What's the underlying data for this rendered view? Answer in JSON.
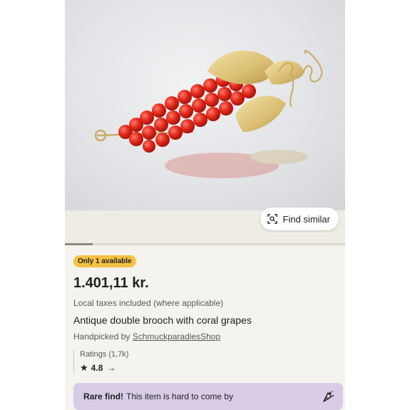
{
  "hero": {
    "image": "coral-grapes-brooch-photo"
  },
  "find_similar": {
    "label": "Find similar",
    "icon": "visual-search-icon"
  },
  "gallery": {
    "progress": 0.1
  },
  "listing": {
    "badge": "Only 1 available",
    "price": "1.401,11 kr.",
    "tax_note": "Local taxes included (where applicable)",
    "title": "Antique double brooch with coral grapes",
    "handpicked_prefix": "Handpicked by ",
    "shop_name": "SchmuckparadiesShop"
  },
  "ratings": {
    "label": "Ratings (1,7k)",
    "star_icon": "star-icon",
    "value": "4.8",
    "arrow": "→"
  },
  "rare_find": {
    "bold": "Rare find!",
    "text": "This item is hard to come by",
    "icon": "sparkle-icon"
  },
  "colors": {
    "badge": "#f5c243",
    "rare_banner": "#d8cce8",
    "page_bg": "#f5f3ee"
  }
}
